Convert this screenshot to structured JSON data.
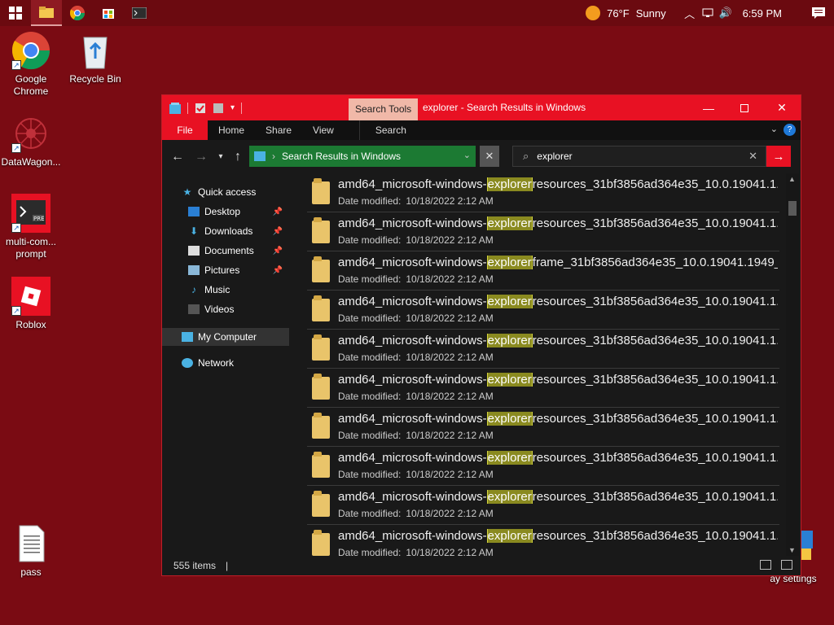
{
  "taskbar": {
    "apps": [
      "windows-start",
      "file-explorer",
      "google-chrome",
      "microsoft-store",
      "terminal"
    ],
    "weather": {
      "temp": "76°F",
      "condition": "Sunny"
    },
    "clock": "6:59 PM"
  },
  "desktop": {
    "icons": [
      {
        "label": "Google Chrome"
      },
      {
        "label": "Recycle Bin"
      },
      {
        "label": "DataWagon..."
      },
      {
        "label": "multi-com... prompt"
      },
      {
        "label": "Roblox"
      },
      {
        "label": "pass"
      },
      {
        "label": "ay settings"
      }
    ]
  },
  "window": {
    "context_tab": "Search Tools",
    "title": "explorer - Search Results in Windows",
    "ribbon_tabs": [
      "File",
      "Home",
      "Share",
      "View",
      "Search"
    ],
    "address": "Search Results in Windows",
    "search_value": "explorer",
    "nav": {
      "quick_access": "Quick access",
      "items": [
        "Desktop",
        "Downloads",
        "Documents",
        "Pictures",
        "Music",
        "Videos"
      ],
      "my_computer": "My Computer",
      "network": "Network"
    },
    "results": [
      {
        "prefix": "amd64_microsoft-windows-",
        "match": "explorer",
        "suffix": "resources_31bf3856ad364e35_10.0.19041.1...",
        "meta_key": "Date modified:",
        "meta_val": "10/18/2022 2:12 AM"
      },
      {
        "prefix": "amd64_microsoft-windows-",
        "match": "explorer",
        "suffix": "resources_31bf3856ad364e35_10.0.19041.1...",
        "meta_key": "Date modified:",
        "meta_val": "10/18/2022 2:12 AM"
      },
      {
        "prefix": "amd64_microsoft-windows-",
        "match": "explorer",
        "suffix": "frame_31bf3856ad364e35_10.0.19041.1949_...",
        "meta_key": "Date modified:",
        "meta_val": "10/18/2022 2:12 AM"
      },
      {
        "prefix": "amd64_microsoft-windows-",
        "match": "explorer",
        "suffix": "resources_31bf3856ad364e35_10.0.19041.1...",
        "meta_key": "Date modified:",
        "meta_val": "10/18/2022 2:12 AM"
      },
      {
        "prefix": "amd64_microsoft-windows-",
        "match": "explorer",
        "suffix": "resources_31bf3856ad364e35_10.0.19041.1...",
        "meta_key": "Date modified:",
        "meta_val": "10/18/2022 2:12 AM"
      },
      {
        "prefix": "amd64_microsoft-windows-",
        "match": "explorer",
        "suffix": "resources_31bf3856ad364e35_10.0.19041.1...",
        "meta_key": "Date modified:",
        "meta_val": "10/18/2022 2:12 AM"
      },
      {
        "prefix": "amd64_microsoft-windows-",
        "match": "explorer",
        "suffix": "resources_31bf3856ad364e35_10.0.19041.1...",
        "meta_key": "Date modified:",
        "meta_val": "10/18/2022 2:12 AM"
      },
      {
        "prefix": "amd64_microsoft-windows-",
        "match": "explorer",
        "suffix": "resources_31bf3856ad364e35_10.0.19041.1...",
        "meta_key": "Date modified:",
        "meta_val": "10/18/2022 2:12 AM"
      },
      {
        "prefix": "amd64_microsoft-windows-",
        "match": "explorer",
        "suffix": "resources_31bf3856ad364e35_10.0.19041.1...",
        "meta_key": "Date modified:",
        "meta_val": "10/18/2022 2:12 AM"
      },
      {
        "prefix": "amd64_microsoft-windows-",
        "match": "explorer",
        "suffix": "resources_31bf3856ad364e35_10.0.19041.1...",
        "meta_key": "Date modified:",
        "meta_val": "10/18/2022 2:12 AM"
      }
    ],
    "status": "555 items"
  },
  "colors": {
    "desktop": "#7a0b13",
    "accent": "#e81123",
    "address_bg": "#1c7a33",
    "highlight": "#8a8a20"
  }
}
